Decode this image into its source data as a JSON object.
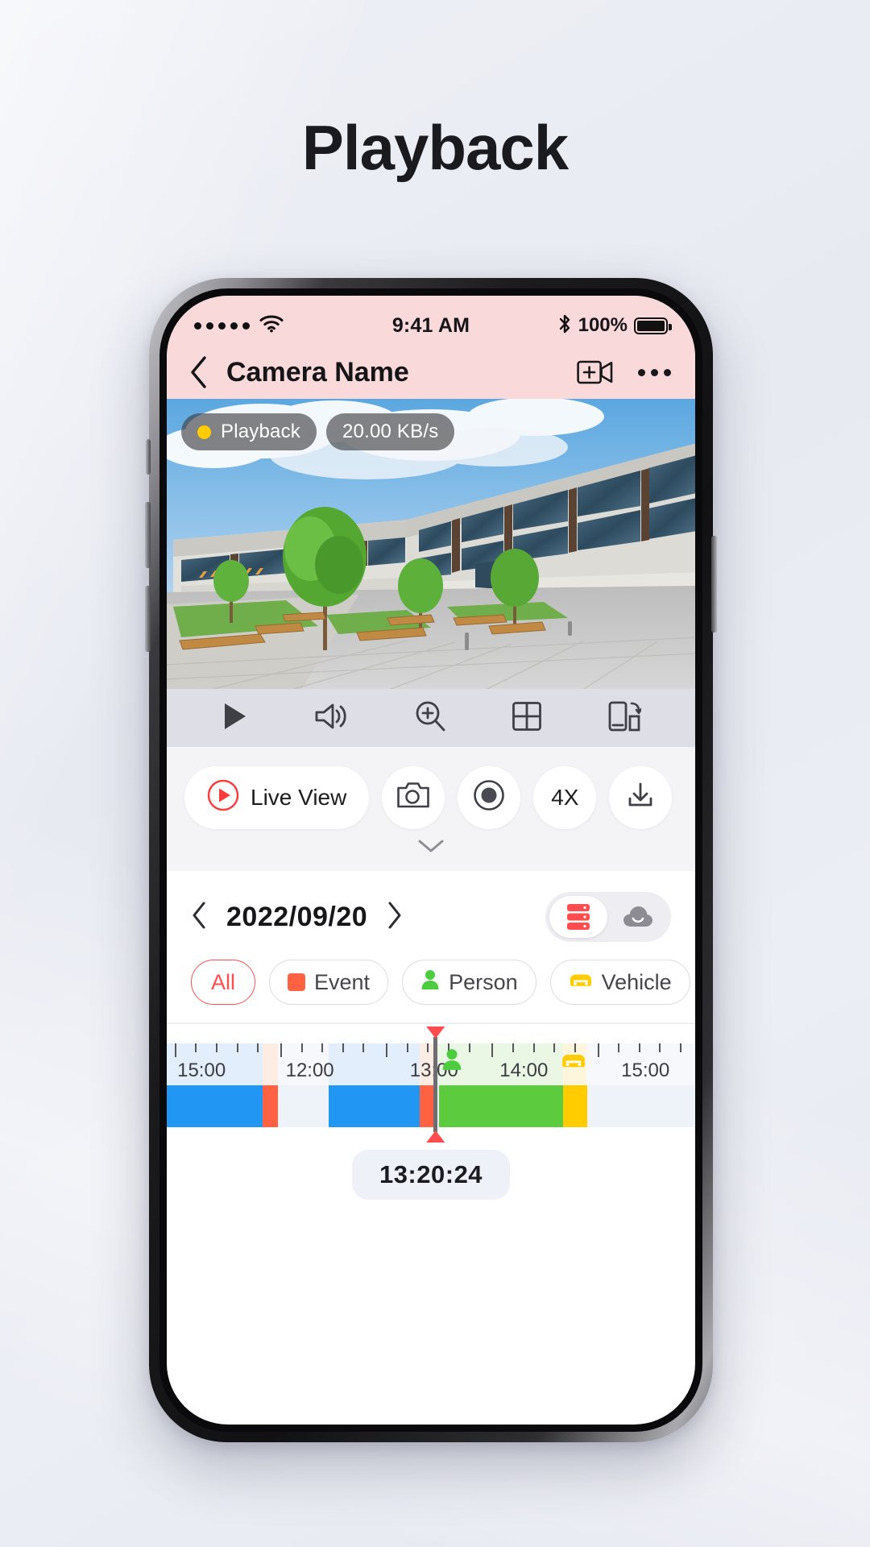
{
  "page": {
    "title": "Playback"
  },
  "status_bar": {
    "signal_icon": "signal-dots-icon",
    "wifi_icon": "wifi-icon",
    "time": "9:41 AM",
    "bluetooth_icon": "bluetooth-icon",
    "battery_percent": "100%",
    "battery_icon": "battery-full-icon"
  },
  "nav": {
    "back_icon": "chevron-left-icon",
    "title": "Camera Name",
    "add_camera_icon": "add-camera-icon",
    "more_icon": "more-horizontal-icon"
  },
  "video": {
    "status_badge": "Playback",
    "status_dot_color": "#ffcc00",
    "bitrate_badge": "20.00 KB/s",
    "scene_description": "office-courtyard-camera-feed"
  },
  "toolbar": [
    {
      "name": "play-icon",
      "label": "Play"
    },
    {
      "name": "volume-icon",
      "label": "Volume"
    },
    {
      "name": "zoom-in-icon",
      "label": "Digital Zoom"
    },
    {
      "name": "multi-view-icon",
      "label": "Multi View"
    },
    {
      "name": "rotate-screen-icon",
      "label": "Rotate"
    }
  ],
  "actions": {
    "live_view": {
      "label": "Live View",
      "icon": "play-circle-icon",
      "accent": "#fb3b3b"
    },
    "items": [
      {
        "name": "snapshot-button",
        "icon": "camera-icon",
        "label": ""
      },
      {
        "name": "record-button",
        "icon": "record-icon",
        "label": ""
      },
      {
        "name": "speed-button",
        "icon": "",
        "label": "4X"
      },
      {
        "name": "download-button",
        "icon": "download-icon",
        "label": ""
      }
    ],
    "collapse_icon": "chevron-down-icon"
  },
  "date_bar": {
    "prev_icon": "chevron-left-icon",
    "date": "2022/09/20",
    "next_icon": "chevron-right-icon",
    "storage_toggle": {
      "device_icon": "device-storage-icon",
      "cloud_icon": "cloud-storage-icon",
      "selected": "device",
      "device_color": "#ff4d4f"
    }
  },
  "filters": [
    {
      "label": "All",
      "selected": true,
      "icon": "",
      "color": "#ff4d4f"
    },
    {
      "label": "Event",
      "selected": false,
      "icon": "event-square-icon",
      "color": "#ff6242"
    },
    {
      "label": "Person",
      "selected": false,
      "icon": "person-icon",
      "color": "#4ccc3e"
    },
    {
      "label": "Vehicle",
      "selected": false,
      "icon": "vehicle-icon",
      "color": "#ffcc00"
    }
  ],
  "timeline": {
    "labels": [
      {
        "text": "15:00",
        "pct": 2
      },
      {
        "text": "12:00",
        "pct": 22.5
      },
      {
        "text": "13:00",
        "pct": 46
      },
      {
        "text": "14:00",
        "pct": 63
      },
      {
        "text": "15:00",
        "pct": 86
      }
    ],
    "markers": [
      {
        "icon": "person-icon",
        "pct": 52.5,
        "color": "#4ccc3e"
      },
      {
        "icon": "vehicle-icon",
        "pct": 75.5,
        "color": "#ffcc00"
      }
    ],
    "segments": [
      {
        "type": "recording",
        "color": "#2196f3",
        "start": 0,
        "end": 18.2
      },
      {
        "type": "event",
        "color": "#ff6242",
        "start": 18.2,
        "end": 21.0
      },
      {
        "type": "recording",
        "color": "#2196f3",
        "start": 30.6,
        "end": 47.9
      },
      {
        "type": "event",
        "color": "#ff6242",
        "start": 47.9,
        "end": 51.2
      },
      {
        "type": "person",
        "color": "#5ccb3e",
        "start": 51.6,
        "end": 75.0
      },
      {
        "type": "vehicle",
        "color": "#ffcc00",
        "start": 75.0,
        "end": 79.5
      }
    ],
    "playhead_pct": 50.5,
    "current_time": "13:20:24"
  }
}
